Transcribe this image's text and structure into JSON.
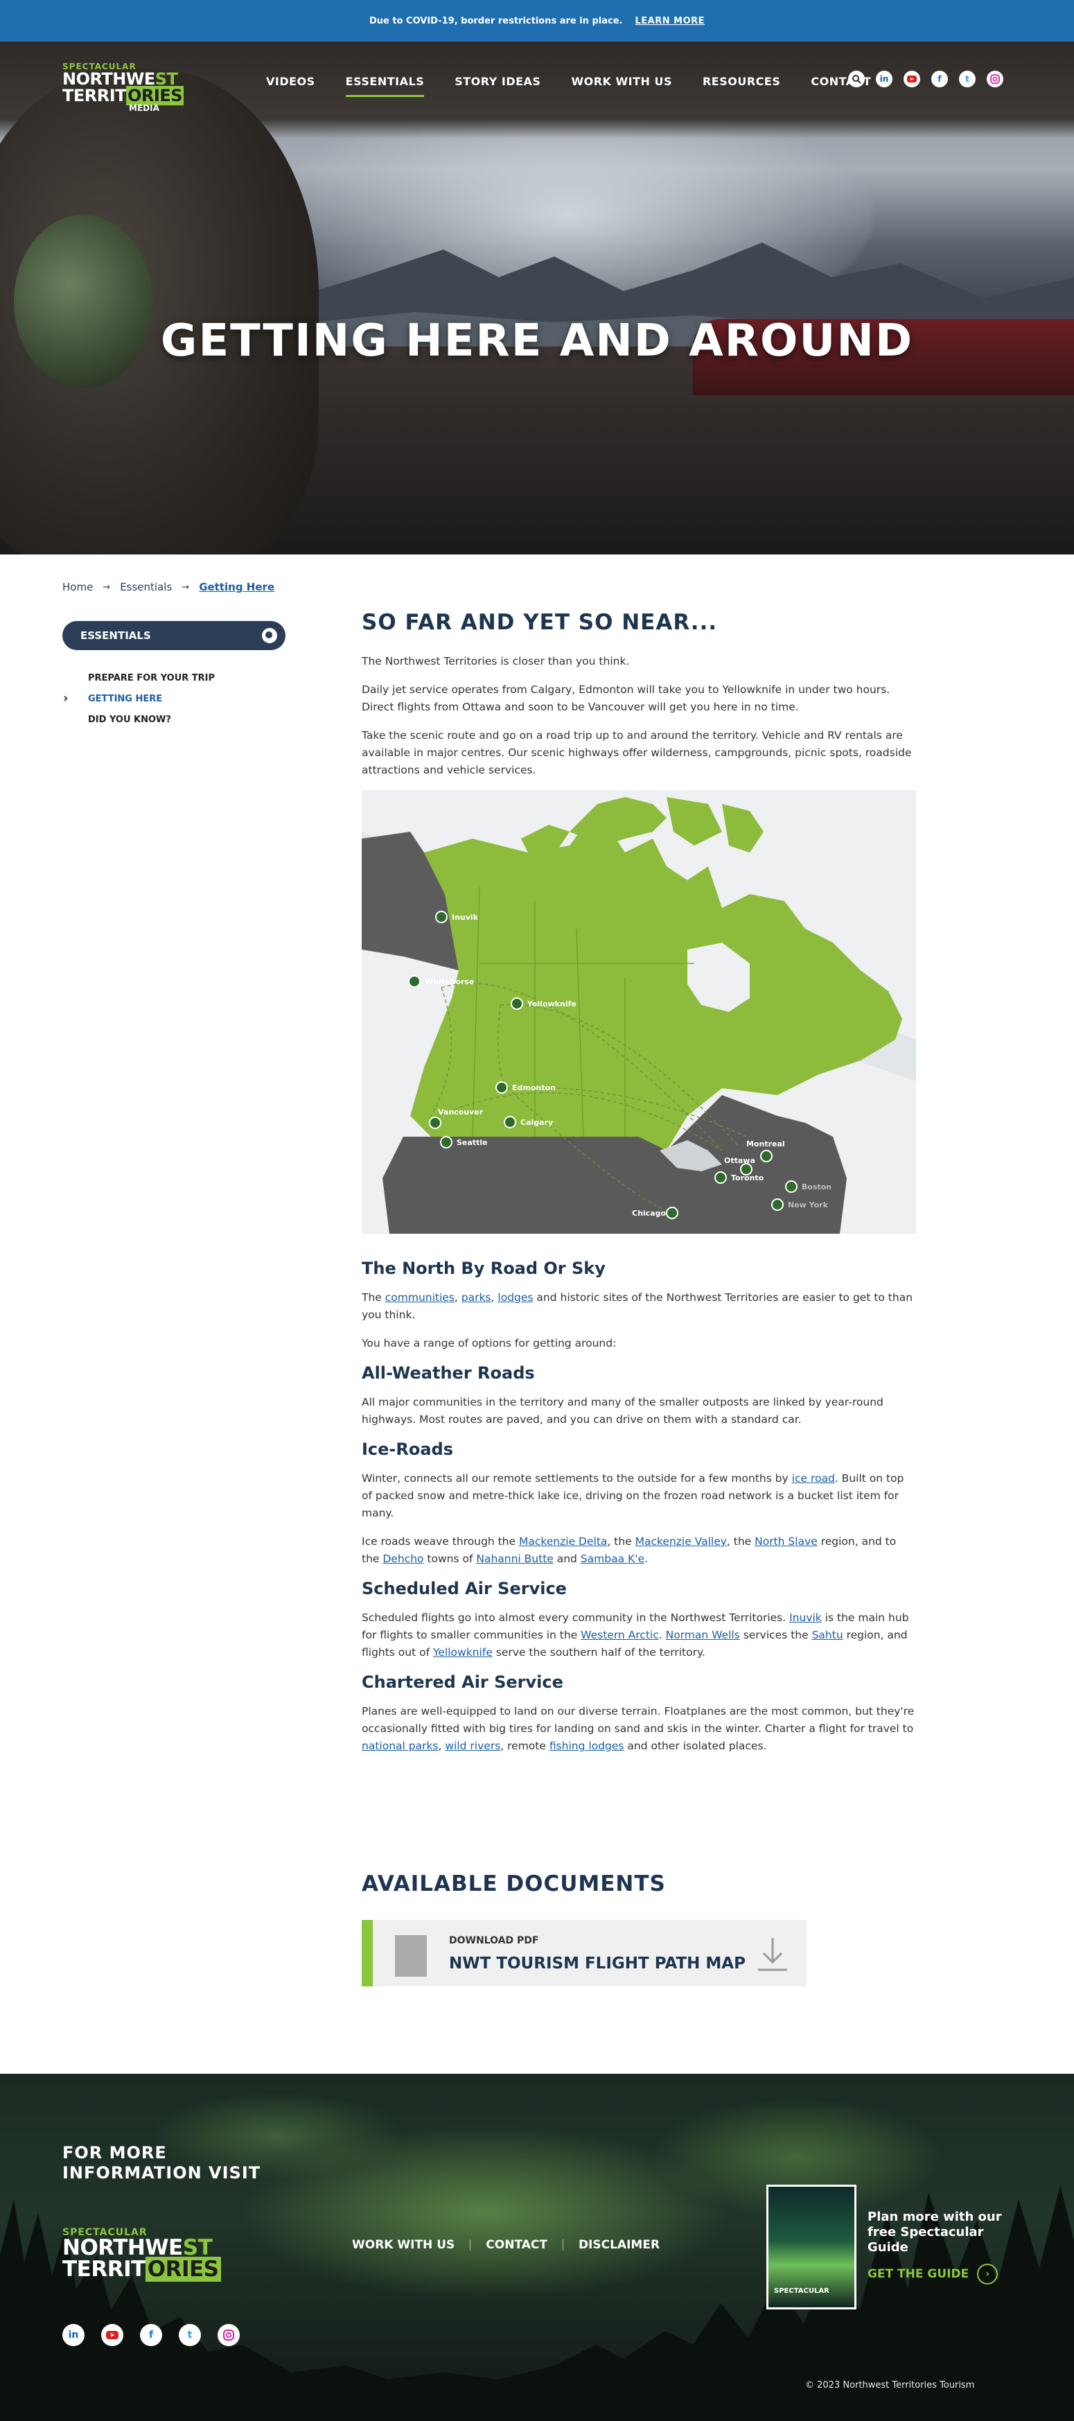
{
  "alert": {
    "text": "Due to COVID-19, border restrictions are in place.",
    "link": "LEARN MORE"
  },
  "logo": {
    "spectacular": "SPECTACULAR",
    "northwe": "NORTHWE",
    "st": "ST",
    "territ": "TERRIT",
    "ories": "ORIES",
    "media": "MEDIA"
  },
  "nav": [
    {
      "label": "VIDEOS",
      "active": false
    },
    {
      "label": "ESSENTIALS",
      "active": true
    },
    {
      "label": "STORY IDEAS",
      "active": false
    },
    {
      "label": "WORK WITH US",
      "active": false
    },
    {
      "label": "RESOURCES",
      "active": false
    },
    {
      "label": "CONTACT",
      "active": false
    }
  ],
  "header_icons": [
    "search-icon",
    "linkedin-icon",
    "youtube-icon",
    "facebook-icon",
    "twitter-icon",
    "instagram-icon"
  ],
  "hero": {
    "title": "GETTING HERE AND AROUND"
  },
  "breadcrumb": [
    "Home",
    "Essentials",
    "Getting Here"
  ],
  "sidebar": {
    "heading": "ESSENTIALS",
    "items": [
      {
        "label": "PREPARE FOR YOUR TRIP",
        "active": false
      },
      {
        "label": "GETTING HERE",
        "active": true
      },
      {
        "label": "DID YOU KNOW?",
        "active": false
      }
    ]
  },
  "main": {
    "title": "SO FAR AND YET SO NEAR...",
    "intro": [
      "The Northwest Territories is closer than you think.",
      "Daily jet service operates from Calgary, Edmonton will take you to Yellowknife in under two hours. Direct flights from Ottawa and soon to be Vancouver will get you here in no time.",
      "Take the scenic route and go on a road trip up to and around the territory. Vehicle and RV rentals are available in major centres. Our scenic highways offer wilderness, campgrounds, picnic spots, roadside attractions and vehicle services."
    ],
    "map_labels": [
      "Inuvik",
      "Whitehorse",
      "Yellowknife",
      "Edmonton",
      "Vancouver",
      "Calgary",
      "Seattle",
      "Montreal",
      "Ottawa",
      "Toronto",
      "Boston",
      "New York",
      "Chicago"
    ],
    "road_sky": {
      "heading": "The North By Road Or Sky",
      "p1_pre": "The ",
      "p1_links": [
        "communities",
        "parks",
        "lodges"
      ],
      "p1_post": " and historic sites of the Northwest Territories are easier to get to than you think.",
      "p2": "You have a range of options for getting around:"
    },
    "all_weather": {
      "heading": "All-Weather Roads",
      "text": "All major communities in the territory and many of the smaller outposts are linked by year-round highways. Most routes are paved, and you can drive on them with a standard car."
    },
    "ice_roads": {
      "heading": "Ice-Roads",
      "p1_pre": "Winter, connects all our remote settlements to the outside for a few months by ",
      "p1_link": "ice road",
      "p1_post": ". Built on top of packed snow and metre-thick lake ice, driving on the frozen road network is a bucket list item for many.",
      "p2_a": "Ice roads weave through the ",
      "p2_l1": "Mackenzie Delta",
      "p2_b": ", the ",
      "p2_l2": "Mackenzie Valley",
      "p2_c": ", the ",
      "p2_l3": "North Slave",
      "p2_d": " region, and to the ",
      "p2_l4": "Dehcho",
      "p2_e": " towns of ",
      "p2_l5": "Nahanni Butte",
      "p2_f": " and ",
      "p2_l6": "Sambaa K'e",
      "p2_g": "."
    },
    "scheduled": {
      "heading": "Scheduled Air Service",
      "a": "Scheduled flights go into almost every community in the Northwest Territories. ",
      "l1": "Inuvik",
      "b": " is the main hub for flights to smaller communities in the ",
      "l2": "Western Arctic",
      "c": ". ",
      "l3": "Norman Wells",
      "d": " services the ",
      "l4": "Sahtu",
      "e": " region, and flights out of ",
      "l5": "Yellowknife",
      "f": " serve the southern half of the territory."
    },
    "chartered": {
      "heading": "Chartered Air Service",
      "a": "Planes are well-equipped to land on our diverse terrain. Floatplanes are the most common, but they're occasionally fitted with big tires for landing on sand and skis in the winter. Charter a flight for travel to ",
      "l1": "national parks",
      "b": ", ",
      "l2": "wild rivers",
      "c": ", remote ",
      "l3": "fishing lodges",
      "d": " and other isolated places."
    }
  },
  "documents": {
    "title": "AVAILABLE DOCUMENTS",
    "download_label": "DOWNLOAD PDF",
    "doc_name": "NWT TOURISM FLIGHT PATH MAP"
  },
  "footer": {
    "visit_line1": "FOR MORE",
    "visit_line2": "INFORMATION VISIT",
    "logo": {
      "spectacular": "SPECTACULAR",
      "northwe": "NORTHWE",
      "st": "ST",
      "territ": "TERRIT",
      "ories": "ORIES"
    },
    "links": [
      "WORK WITH US",
      "CONTACT",
      "DISCLAIMER"
    ],
    "social": [
      "linkedin-icon",
      "youtube-icon",
      "facebook-icon",
      "twitter-icon",
      "instagram-icon"
    ],
    "guide_cover_text": "SPECTACULAR",
    "guide_text": "Plan more with our free Spectacular Guide",
    "guide_button": "GET THE GUIDE",
    "copyright": "© 2023 Northwest Territories Tourism"
  },
  "colors": {
    "accent_green": "#8cc63f",
    "navy": "#1d3550",
    "alert_blue": "#1f6fb0",
    "link_blue": "#1a5ea8"
  }
}
